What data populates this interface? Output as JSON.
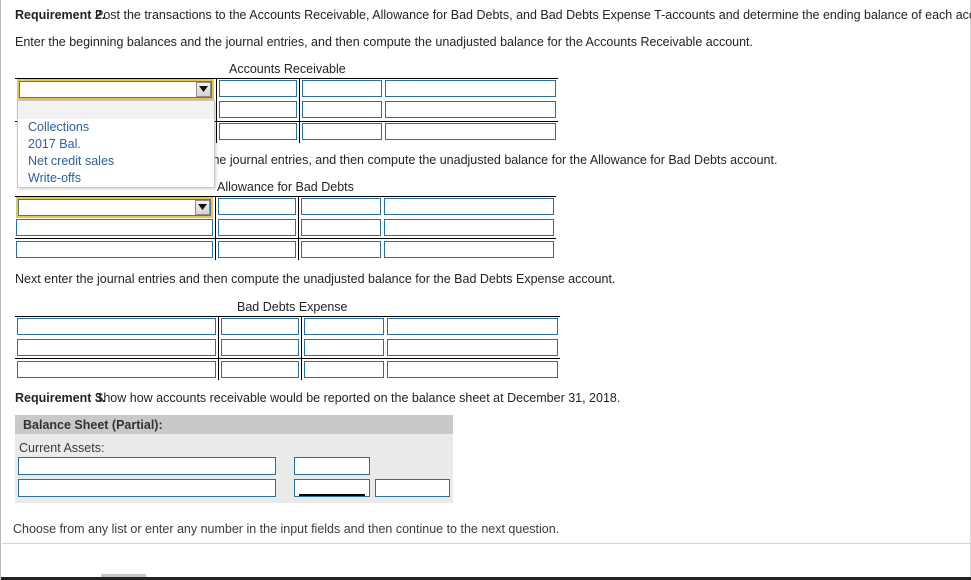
{
  "instructions": {
    "req2_label": "Requirement 2.",
    "req2_text": " Post the transactions to the Accounts Receivable, Allowance for Bad Debts, and Bad Debts Expense T-accounts and determine the ending balance of each account.",
    "line_ar": "Enter the beginning balances and the journal entries, and then compute the unadjusted balance for the Accounts Receivable account.",
    "line_allowance_visible": "the journal entries, and then compute the unadjusted balance for the Allowance for Bad Debts account.",
    "line_bde": "Next enter the journal entries and then compute the unadjusted balance for the Bad Debts Expense account.",
    "req3_label": "Requirement 3.",
    "req3_text": " Show how accounts receivable would be reported on the balance sheet at December 31, 2018.",
    "footer": "Choose from any list or enter any number in the input fields and then continue to the next question."
  },
  "accounts": {
    "accounts_receivable": "Accounts Receivable",
    "allowance_for_bad_debts": "Allowance for Bad Debts",
    "bad_debts_expense": "Bad Debts Expense"
  },
  "dropdown": {
    "open": true,
    "selected_value": "",
    "arrow_icon": "chevron-down-icon",
    "options": [
      "",
      "Collections",
      "2017 Bal.",
      "Net credit sales",
      "Write-offs"
    ]
  },
  "combo_values": {
    "accounts_receivable_row1": "",
    "allowance_row1": ""
  },
  "input_values": {
    "ar": [
      [
        "",
        "",
        "",
        ""
      ],
      [
        "",
        "",
        "",
        ""
      ],
      [
        "",
        "",
        "",
        ""
      ]
    ],
    "allowance": [
      [
        "",
        "",
        "",
        ""
      ],
      [
        "",
        "",
        "",
        ""
      ],
      [
        "",
        "",
        "",
        ""
      ]
    ],
    "bde": [
      [
        "",
        "",
        "",
        ""
      ],
      [
        "",
        "",
        "",
        ""
      ],
      [
        "",
        "",
        "",
        ""
      ]
    ]
  },
  "balance_sheet": {
    "title": "Balance Sheet (Partial):",
    "section_label": "Current Assets:",
    "rows": [
      {
        "label": "",
        "amount": "",
        "total": null
      },
      {
        "label": "",
        "amount": "",
        "total": ""
      }
    ]
  },
  "colors": {
    "input_border": "#2a7099",
    "focus_border": "#e8c552",
    "panel_header": "#c9c9c9",
    "panel_body": "#eaeaea",
    "option_text": "#2b5f9e",
    "rule": "#000000"
  }
}
